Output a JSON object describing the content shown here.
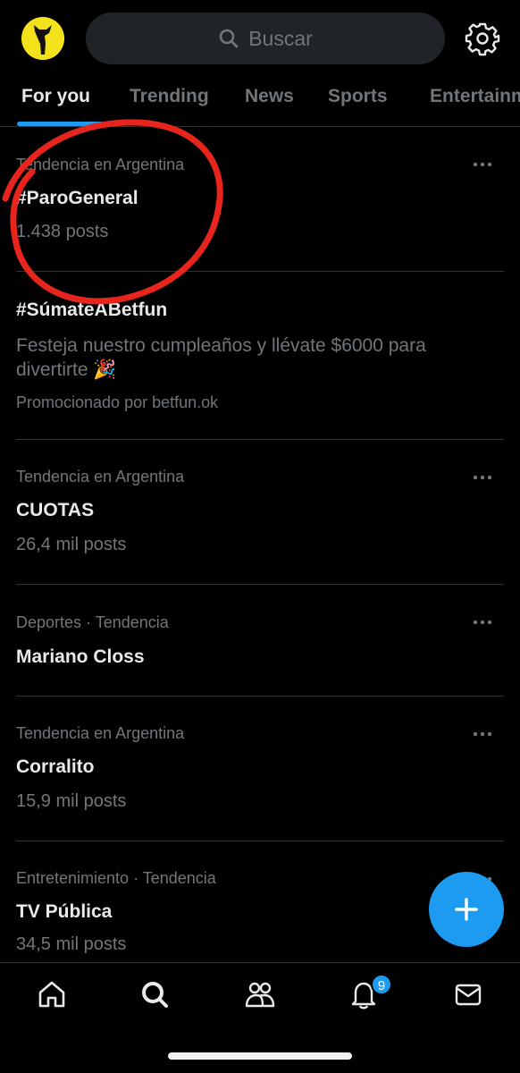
{
  "header": {
    "search_placeholder": "Buscar",
    "avatar_icon": "avatar-silhouette",
    "settings_icon": "gear-icon"
  },
  "tabs": [
    {
      "label": "For you",
      "active": true
    },
    {
      "label": "Trending",
      "active": false
    },
    {
      "label": "News",
      "active": false
    },
    {
      "label": "Sports",
      "active": false
    },
    {
      "label": "Entertainment",
      "active": false
    }
  ],
  "trends": [
    {
      "meta": "Tendencia en Argentina",
      "name": "#ParoGeneral",
      "count": "1.438 posts"
    },
    {
      "name": "#SúmateABetfun",
      "description": "Festeja nuestro cumpleaños y llévate $6000 para divertirte 🎉",
      "promo": "Promocionado por betfun.ok"
    },
    {
      "meta": "Tendencia en Argentina",
      "name": "CUOTAS",
      "count": "26,4 mil posts"
    },
    {
      "meta": "Deportes · Tendencia",
      "name": "Mariano Closs"
    },
    {
      "meta": "Tendencia en Argentina",
      "name": "Corralito",
      "count": "15,9 mil posts"
    },
    {
      "meta": "Entretenimiento · Tendencia",
      "name": "TV Pública",
      "count": "34,5 mil posts"
    }
  ],
  "annotation": {
    "color": "#e8251c"
  },
  "bottom_nav": {
    "items": [
      "home-icon",
      "search-icon",
      "communities-icon",
      "notifications-icon",
      "messages-icon"
    ],
    "notification_badge": "9"
  },
  "colors": {
    "accent": "#1d9bf0",
    "background": "#000000",
    "muted": "#71767b"
  }
}
